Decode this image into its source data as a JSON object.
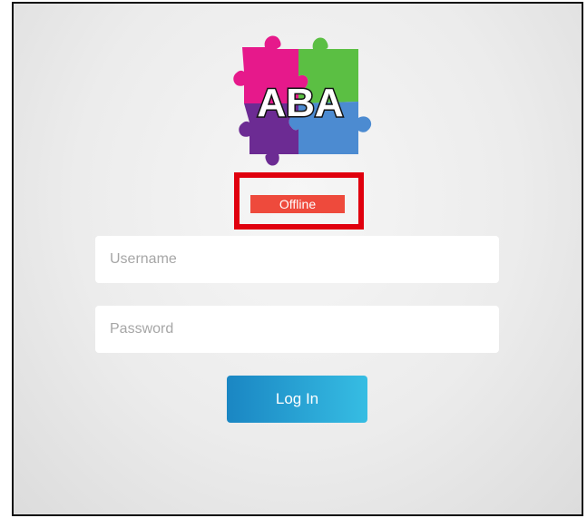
{
  "logo": {
    "text": "ABA",
    "piece_colors": {
      "top_left": "#e6198b",
      "top_right": "#5bbf43",
      "bottom_left": "#6c2b93",
      "bottom_right": "#4c8bd1"
    }
  },
  "status": {
    "label": "Offline",
    "badge_color": "#ee4a3c",
    "highlight_color": "#e0000e"
  },
  "login_form": {
    "username_placeholder": "Username",
    "password_placeholder": "Password",
    "username_value": "",
    "password_value": "",
    "submit_label": "Log In",
    "submit_color": "#1a86c3"
  }
}
